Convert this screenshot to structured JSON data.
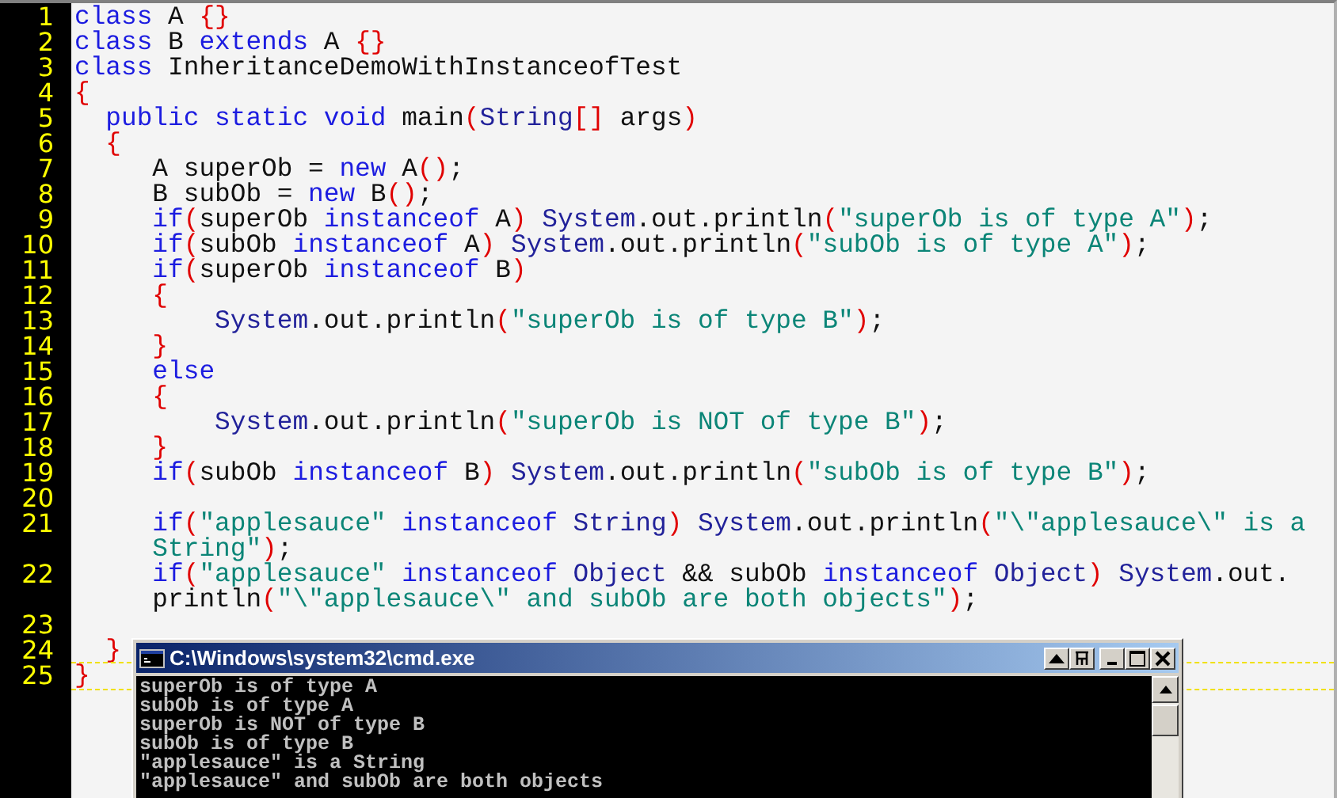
{
  "editor": {
    "lines": [
      {
        "number": "1",
        "rows": [
          {
            "tokens": [
              {
                "kind": "keyword",
                "text": "class"
              },
              {
                "kind": "plain",
                "text": " A "
              },
              {
                "kind": "bracket",
                "text": "{}"
              }
            ]
          }
        ]
      },
      {
        "number": "2",
        "rows": [
          {
            "tokens": [
              {
                "kind": "keyword",
                "text": "class"
              },
              {
                "kind": "plain",
                "text": " B "
              },
              {
                "kind": "keyword",
                "text": "extends"
              },
              {
                "kind": "plain",
                "text": " A "
              },
              {
                "kind": "bracket",
                "text": "{}"
              }
            ]
          }
        ]
      },
      {
        "number": "3",
        "rows": [
          {
            "tokens": [
              {
                "kind": "keyword",
                "text": "class"
              },
              {
                "kind": "plain",
                "text": " InheritanceDemoWithInstanceofTest"
              }
            ]
          }
        ]
      },
      {
        "number": "4",
        "rows": [
          {
            "tokens": [
              {
                "kind": "bracket",
                "text": "{"
              }
            ]
          }
        ]
      },
      {
        "number": "5",
        "rows": [
          {
            "tokens": [
              {
                "kind": "keyword",
                "text": "  public static void"
              },
              {
                "kind": "plain",
                "text": " main"
              },
              {
                "kind": "bracket",
                "text": "("
              },
              {
                "kind": "type",
                "text": "String"
              },
              {
                "kind": "bracket",
                "text": "[]"
              },
              {
                "kind": "plain",
                "text": " args"
              },
              {
                "kind": "bracket",
                "text": ")"
              }
            ]
          }
        ]
      },
      {
        "number": "6",
        "rows": [
          {
            "tokens": [
              {
                "kind": "bracket",
                "text": "  {"
              }
            ]
          }
        ]
      },
      {
        "number": "7",
        "rows": [
          {
            "tokens": [
              {
                "kind": "plain",
                "text": "     A superOb = "
              },
              {
                "kind": "keyword",
                "text": "new"
              },
              {
                "kind": "plain",
                "text": " A"
              },
              {
                "kind": "bracket",
                "text": "()"
              },
              {
                "kind": "plain",
                "text": ";"
              }
            ]
          }
        ]
      },
      {
        "number": "8",
        "rows": [
          {
            "tokens": [
              {
                "kind": "plain",
                "text": "     B subOb = "
              },
              {
                "kind": "keyword",
                "text": "new"
              },
              {
                "kind": "plain",
                "text": " B"
              },
              {
                "kind": "bracket",
                "text": "()"
              },
              {
                "kind": "plain",
                "text": ";"
              }
            ]
          }
        ]
      },
      {
        "number": "9",
        "rows": [
          {
            "tokens": [
              {
                "kind": "keyword",
                "text": "     if"
              },
              {
                "kind": "bracket",
                "text": "("
              },
              {
                "kind": "plain",
                "text": "superOb "
              },
              {
                "kind": "keyword",
                "text": "instanceof"
              },
              {
                "kind": "plain",
                "text": " A"
              },
              {
                "kind": "bracket",
                "text": ")"
              },
              {
                "kind": "type",
                "text": " System"
              },
              {
                "kind": "plain",
                "text": ".out.println"
              },
              {
                "kind": "bracket",
                "text": "("
              },
              {
                "kind": "string",
                "text": "\"superOb is of type A\""
              },
              {
                "kind": "bracket",
                "text": ")"
              },
              {
                "kind": "plain",
                "text": ";"
              }
            ]
          }
        ]
      },
      {
        "number": "10",
        "rows": [
          {
            "tokens": [
              {
                "kind": "keyword",
                "text": "     if"
              },
              {
                "kind": "bracket",
                "text": "("
              },
              {
                "kind": "plain",
                "text": "subOb "
              },
              {
                "kind": "keyword",
                "text": "instanceof"
              },
              {
                "kind": "plain",
                "text": " A"
              },
              {
                "kind": "bracket",
                "text": ")"
              },
              {
                "kind": "type",
                "text": " System"
              },
              {
                "kind": "plain",
                "text": ".out.println"
              },
              {
                "kind": "bracket",
                "text": "("
              },
              {
                "kind": "string",
                "text": "\"subOb is of type A\""
              },
              {
                "kind": "bracket",
                "text": ")"
              },
              {
                "kind": "plain",
                "text": ";"
              }
            ]
          }
        ]
      },
      {
        "number": "11",
        "rows": [
          {
            "tokens": [
              {
                "kind": "keyword",
                "text": "     if"
              },
              {
                "kind": "bracket",
                "text": "("
              },
              {
                "kind": "plain",
                "text": "superOb "
              },
              {
                "kind": "keyword",
                "text": "instanceof"
              },
              {
                "kind": "plain",
                "text": " B"
              },
              {
                "kind": "bracket",
                "text": ")"
              }
            ]
          }
        ]
      },
      {
        "number": "12",
        "rows": [
          {
            "tokens": [
              {
                "kind": "bracket",
                "text": "     {"
              }
            ]
          }
        ]
      },
      {
        "number": "13",
        "rows": [
          {
            "tokens": [
              {
                "kind": "type",
                "text": "         System"
              },
              {
                "kind": "plain",
                "text": ".out.println"
              },
              {
                "kind": "bracket",
                "text": "("
              },
              {
                "kind": "string",
                "text": "\"superOb is of type B\""
              },
              {
                "kind": "bracket",
                "text": ")"
              },
              {
                "kind": "plain",
                "text": ";"
              }
            ]
          }
        ]
      },
      {
        "number": "14",
        "rows": [
          {
            "tokens": [
              {
                "kind": "bracket",
                "text": "     }"
              }
            ]
          }
        ]
      },
      {
        "number": "15",
        "rows": [
          {
            "tokens": [
              {
                "kind": "keyword",
                "text": "     else"
              }
            ]
          }
        ]
      },
      {
        "number": "16",
        "rows": [
          {
            "tokens": [
              {
                "kind": "bracket",
                "text": "     {"
              }
            ]
          }
        ]
      },
      {
        "number": "17",
        "rows": [
          {
            "tokens": [
              {
                "kind": "type",
                "text": "         System"
              },
              {
                "kind": "plain",
                "text": ".out.println"
              },
              {
                "kind": "bracket",
                "text": "("
              },
              {
                "kind": "string",
                "text": "\"superOb is NOT of type B\""
              },
              {
                "kind": "bracket",
                "text": ")"
              },
              {
                "kind": "plain",
                "text": ";"
              }
            ]
          }
        ]
      },
      {
        "number": "18",
        "rows": [
          {
            "tokens": [
              {
                "kind": "bracket",
                "text": "     }"
              }
            ]
          }
        ]
      },
      {
        "number": "19",
        "rows": [
          {
            "tokens": [
              {
                "kind": "keyword",
                "text": "     if"
              },
              {
                "kind": "bracket",
                "text": "("
              },
              {
                "kind": "plain",
                "text": "subOb "
              },
              {
                "kind": "keyword",
                "text": "instanceof"
              },
              {
                "kind": "plain",
                "text": " B"
              },
              {
                "kind": "bracket",
                "text": ")"
              },
              {
                "kind": "type",
                "text": " System"
              },
              {
                "kind": "plain",
                "text": ".out.println"
              },
              {
                "kind": "bracket",
                "text": "("
              },
              {
                "kind": "string",
                "text": "\"subOb is of type B\""
              },
              {
                "kind": "bracket",
                "text": ")"
              },
              {
                "kind": "plain",
                "text": ";"
              }
            ]
          }
        ]
      },
      {
        "number": "20"
      },
      {
        "number": "21",
        "rows": [
          {
            "tokens": [
              {
                "kind": "keyword",
                "text": "     if"
              },
              {
                "kind": "bracket",
                "text": "("
              },
              {
                "kind": "string",
                "text": "\"applesauce\""
              },
              {
                "kind": "keyword",
                "text": " instanceof"
              },
              {
                "kind": "type",
                "text": " String"
              },
              {
                "kind": "bracket",
                "text": ")"
              },
              {
                "kind": "type",
                "text": " System"
              },
              {
                "kind": "plain",
                "text": ".out.println"
              },
              {
                "kind": "bracket",
                "text": "("
              },
              {
                "kind": "string",
                "text": "\"\\\"applesauce\\\" is a"
              }
            ]
          },
          {
            "tokens": [
              {
                "kind": "string",
                "text": "     String\""
              },
              {
                "kind": "bracket",
                "text": ")"
              },
              {
                "kind": "plain",
                "text": ";"
              }
            ]
          }
        ]
      },
      {
        "number": "22",
        "rows": [
          {
            "tokens": [
              {
                "kind": "keyword",
                "text": "     if"
              },
              {
                "kind": "bracket",
                "text": "("
              },
              {
                "kind": "string",
                "text": "\"applesauce\""
              },
              {
                "kind": "keyword",
                "text": " instanceof"
              },
              {
                "kind": "type",
                "text": " Object"
              },
              {
                "kind": "plain",
                "text": " && subOb "
              },
              {
                "kind": "keyword",
                "text": "instanceof"
              },
              {
                "kind": "type",
                "text": " Object"
              },
              {
                "kind": "bracket",
                "text": ")"
              },
              {
                "kind": "type",
                "text": " System"
              },
              {
                "kind": "plain",
                "text": ".out."
              }
            ]
          },
          {
            "tokens": [
              {
                "kind": "plain",
                "text": "     println"
              },
              {
                "kind": "bracket",
                "text": "("
              },
              {
                "kind": "string",
                "text": "\"\\\"applesauce\\\" and subOb are both objects\""
              },
              {
                "kind": "bracket",
                "text": ")"
              },
              {
                "kind": "plain",
                "text": ";"
              }
            ]
          }
        ]
      },
      {
        "number": "23"
      },
      {
        "number": "24",
        "rows": [
          {
            "tokens": [
              {
                "kind": "bracket",
                "text": "  }"
              }
            ]
          }
        ]
      },
      {
        "number": "25",
        "current": true,
        "rows": [
          {
            "tokens": [
              {
                "kind": "bracket",
                "text": "}"
              }
            ]
          }
        ]
      }
    ]
  },
  "console": {
    "title": "C:\\Windows\\system32\\cmd.exe",
    "lines": [
      "superOb is of type A",
      "subOb is of type A",
      "superOb is NOT of type B",
      "subOb is of type B",
      "\"applesauce\" is a String",
      "\"applesauce\" and subOb are both objects"
    ]
  }
}
